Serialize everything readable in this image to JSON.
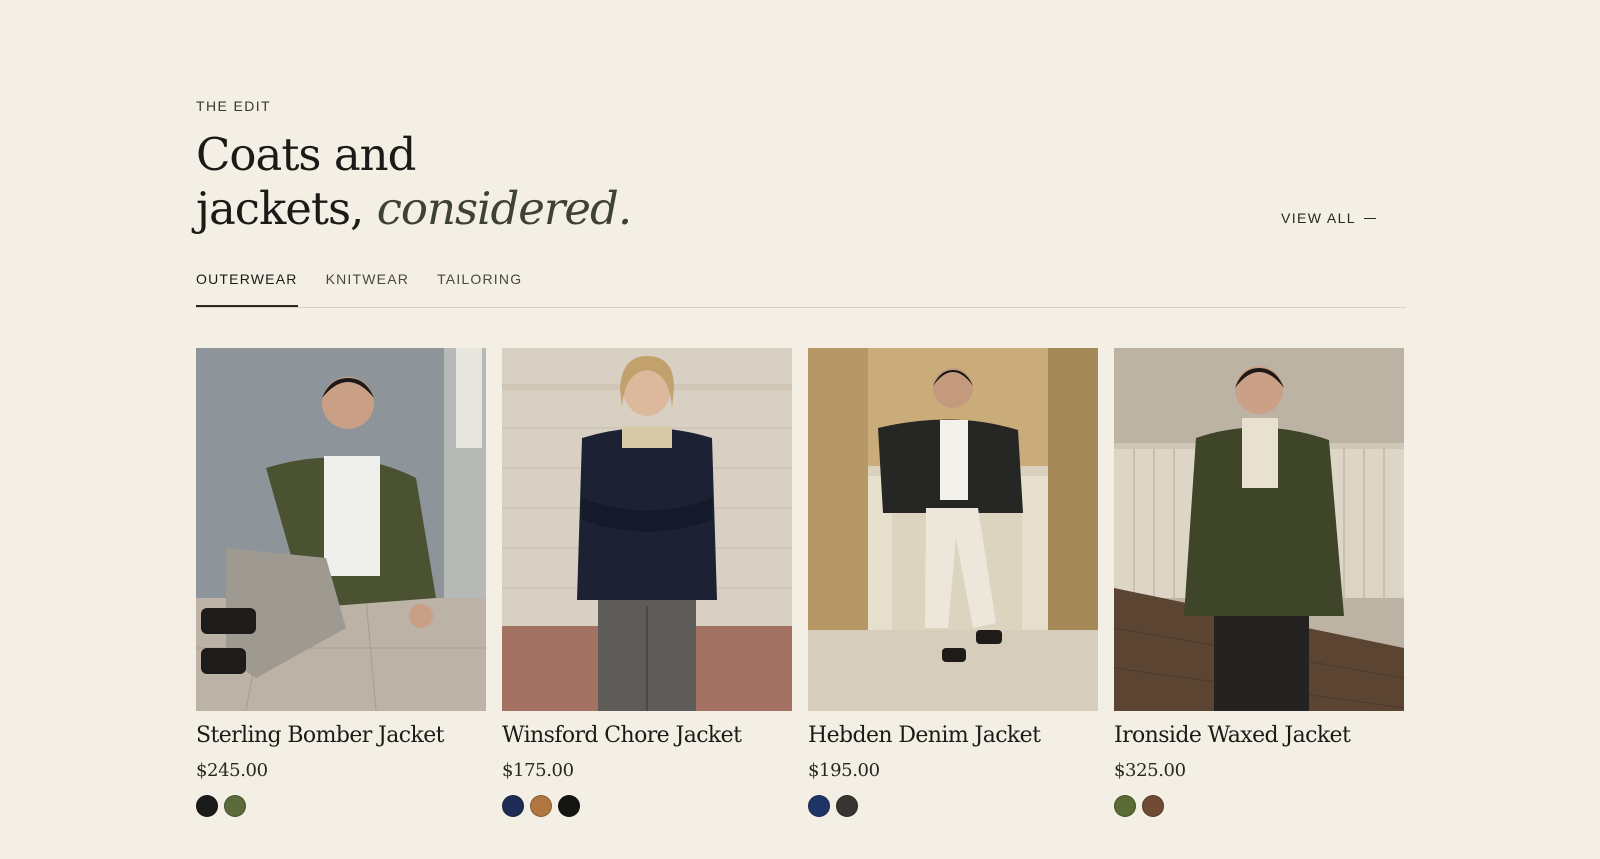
{
  "section": {
    "eyebrow": "THE EDIT",
    "headline_line1": "Coats and",
    "headline_line2": "jackets,",
    "headline_accent": "considered.",
    "view_all": "VIEW ALL"
  },
  "tabs": [
    {
      "label": "OUTERWEAR",
      "active": true
    },
    {
      "label": "KNITWEAR",
      "active": false
    },
    {
      "label": "TAILORING",
      "active": false
    }
  ],
  "products": [
    {
      "name": "Sterling Bomber Jacket",
      "price": "$245.00",
      "swatches": [
        "#1a1a18",
        "#5c6b3a"
      ],
      "image": "man seated on floor in olive bomber jacket"
    },
    {
      "name": "Winsford Chore Jacket",
      "price": "$175.00",
      "swatches": [
        "#1e2c55",
        "#b07840",
        "#151513"
      ],
      "image": "man standing in navy chore jacket against brick wall"
    },
    {
      "name": "Hebden Denim Jacket",
      "price": "$195.00",
      "swatches": [
        "#1f3566",
        "#363532"
      ],
      "image": "man leaning on fireplace in black denim jacket"
    },
    {
      "name": "Ironside Waxed Jacket",
      "price": "$325.00",
      "swatches": [
        "#5b6b36",
        "#6e4b32"
      ],
      "image": "man in olive waxed field jacket in paneled room"
    }
  ],
  "colors": {
    "background": "#f4efe4",
    "text": "#1c1a17",
    "accent": "#3d4233"
  }
}
